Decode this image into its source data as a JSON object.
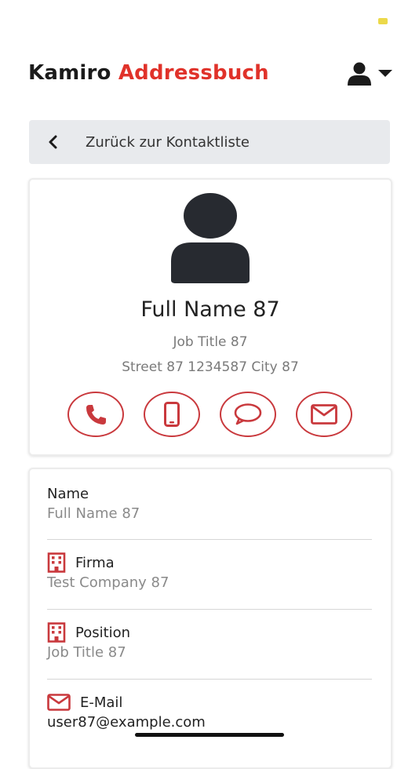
{
  "header": {
    "logo_primary": "Kamiro",
    "logo_accent": "Addressbuch"
  },
  "icons": {
    "user_menu": "user-icon",
    "dropdown": "caret-down-icon",
    "back": "chevron-left-icon",
    "avatar": "person-icon",
    "call": "phone-icon",
    "mobile": "mobile-phone-icon",
    "message": "chat-bubble-icon",
    "email": "envelope-icon",
    "company": "building-icon"
  },
  "colors": {
    "accent": "#e0322a",
    "action_red": "#c9393d",
    "back_bar_bg": "#e8eaed"
  },
  "back": {
    "label": "Zurück zur Kontaktliste"
  },
  "profile": {
    "full_name": "Full Name 87",
    "job_title": "Job Title 87",
    "address": "Street 87 1234587 City 87"
  },
  "details": {
    "fields": [
      {
        "label": "Name",
        "value": "Full Name 87"
      },
      {
        "label": "Firma",
        "value": "Test Company 87"
      },
      {
        "label": "Position",
        "value": "Job Title 87"
      },
      {
        "label": "E-Mail",
        "value": "user87@example.com"
      }
    ]
  }
}
